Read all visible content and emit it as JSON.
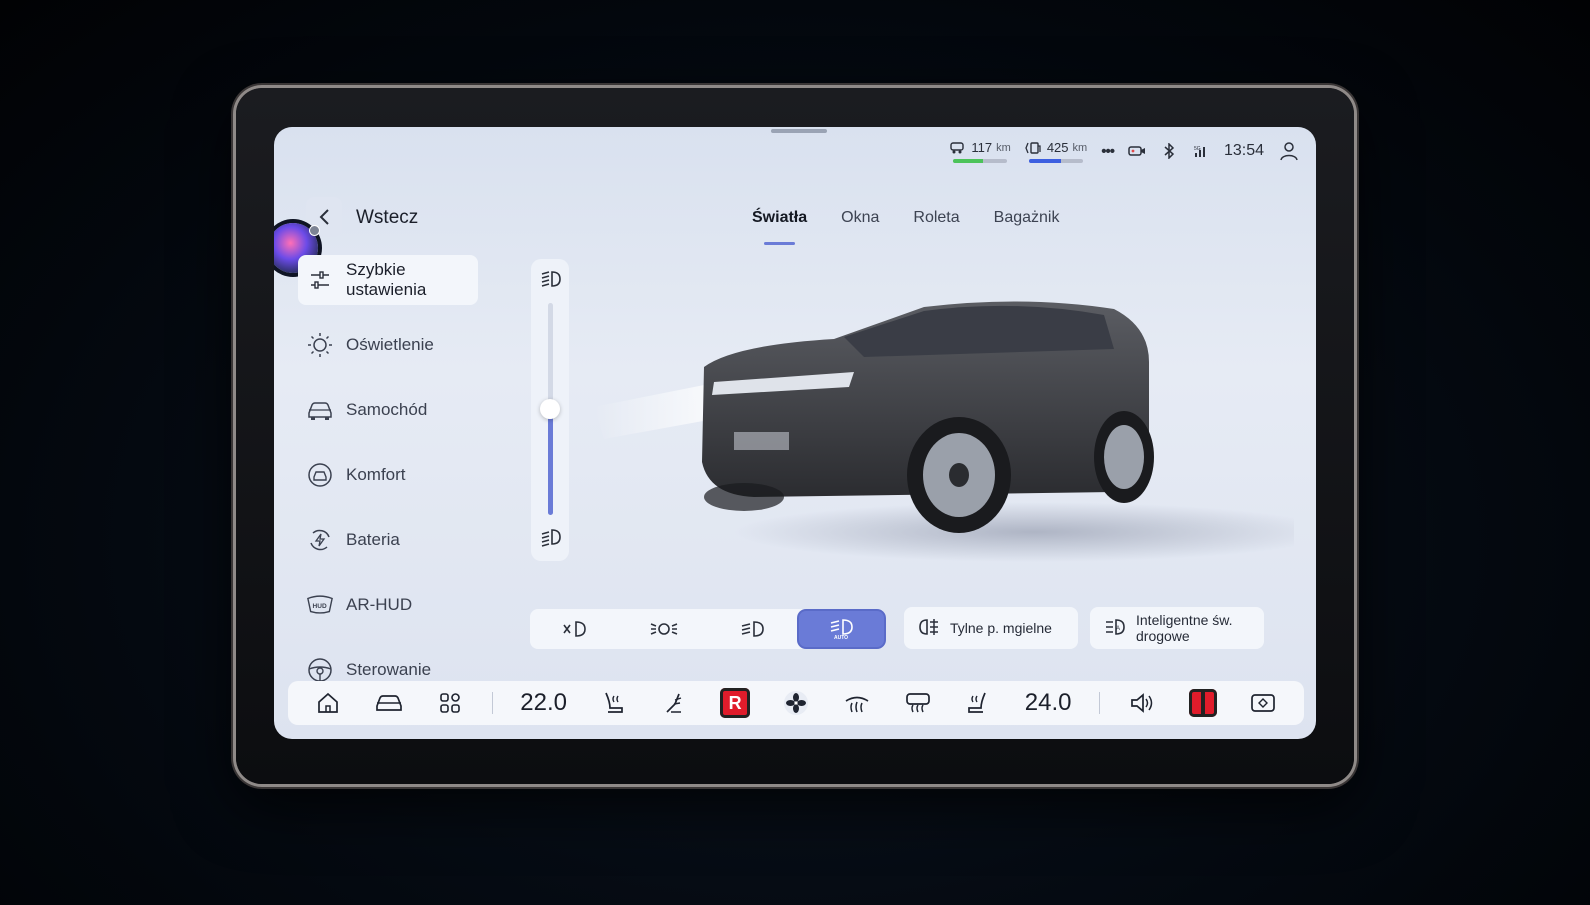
{
  "status": {
    "range1_value": "117",
    "range1_unit": "km",
    "range1_level": 0.55,
    "range2_value": "425",
    "range2_unit": "km",
    "range2_level": 0.6,
    "time": "13:54",
    "more": "•••"
  },
  "nav": {
    "back_label": "Wstecz"
  },
  "tabs": [
    {
      "label": "Światła"
    },
    {
      "label": "Okna"
    },
    {
      "label": "Roleta"
    },
    {
      "label": "Bagażnik"
    }
  ],
  "sidebar": {
    "items": [
      {
        "line1": "Szybkie",
        "line2": "ustawienia"
      },
      {
        "label": "Oświetlenie"
      },
      {
        "label": "Samochód"
      },
      {
        "label": "Komfort"
      },
      {
        "label": "Bateria"
      },
      {
        "label": "AR-HUD"
      },
      {
        "label": "Sterowanie"
      }
    ]
  },
  "headlight_level": 0.5,
  "controls": {
    "fog_label": "Tylne p. mgielne",
    "smart_line1": "Inteligentne św.",
    "smart_line2": "drogowe"
  },
  "dock": {
    "temp_left": "22.0",
    "temp_right": "24.0",
    "badge": "R"
  },
  "colors": {
    "accent": "#6a7bd7",
    "range1_bar": "#4cc35a",
    "range2_bar": "#3d5fe0",
    "badge_red": "#e01c2b"
  }
}
